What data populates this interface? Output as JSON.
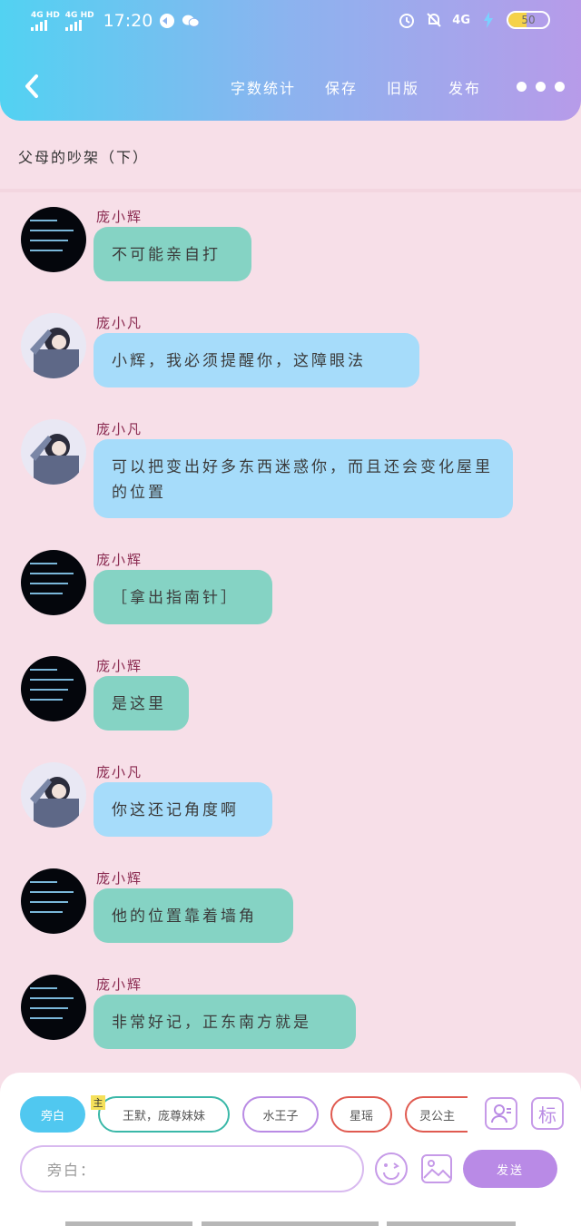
{
  "status_bar": {
    "signal1": "4G HD",
    "signal2": "4G HD",
    "time": "17:20",
    "network": "4G",
    "battery": "50"
  },
  "nav": {
    "back_icon": "chevron-left-icon",
    "links": [
      "字数统计",
      "保存",
      "旧版",
      "发布"
    ],
    "more_icon": "more-dots-icon"
  },
  "title": "父母的吵架（下）",
  "messages": [
    {
      "sender": "庞小辉",
      "text": "不可能亲自打",
      "style": "teal",
      "avatar": "dark"
    },
    {
      "sender": "庞小凡",
      "text": "小辉，我必须提醒你，这障眼法",
      "style": "blue",
      "avatar": "light"
    },
    {
      "sender": "庞小凡",
      "text": "可以把变出好多东西迷惑你，而且还会变化屋里的位置",
      "style": "blue",
      "avatar": "light"
    },
    {
      "sender": "庞小辉",
      "text": "［拿出指南针］",
      "style": "teal",
      "avatar": "dark"
    },
    {
      "sender": "庞小辉",
      "text": "是这里",
      "style": "teal",
      "avatar": "dark"
    },
    {
      "sender": "庞小凡",
      "text": "你这还记角度啊",
      "style": "blue",
      "avatar": "light"
    },
    {
      "sender": "庞小辉",
      "text": "他的位置靠着墙角",
      "style": "teal",
      "avatar": "dark"
    },
    {
      "sender": "庞小辉",
      "text": "非常好记，正东南方就是",
      "style": "teal",
      "avatar": "dark"
    }
  ],
  "roles": [
    {
      "label": "旁白",
      "border": "#50c8f0",
      "selected": true
    },
    {
      "label": "王默，庞尊妹妹",
      "border": "#3ab8a8",
      "selected": false
    },
    {
      "label": "水王子",
      "border": "#b98be4",
      "selected": false
    },
    {
      "label": "星瑶",
      "border": "#e05a50",
      "selected": false
    },
    {
      "label": "灵公主",
      "border": "#e05a50",
      "selected": false
    }
  ],
  "main_tag": "主",
  "tools": {
    "profile_icon": "person-card-icon",
    "mark_label": "标",
    "emoji_icon": "smile-icon",
    "image_icon": "image-icon"
  },
  "input": {
    "placeholder": "旁白："
  },
  "send_label": "发送",
  "colors": {
    "teal_bubble": "#85d3c4",
    "blue_bubble": "#a6dcfa",
    "accent_purple": "#b98ae6",
    "background": "#f7dfe8"
  }
}
